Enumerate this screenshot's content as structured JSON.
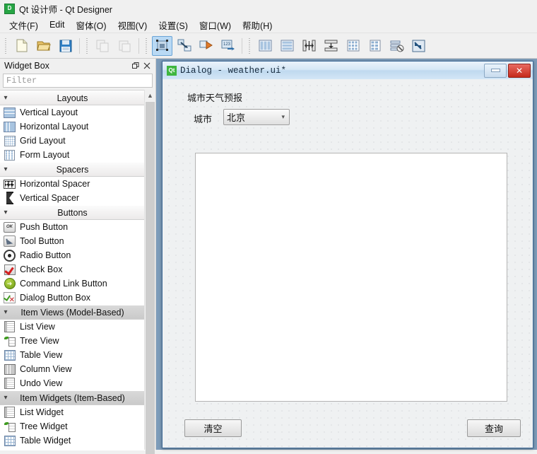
{
  "window": {
    "title": "Qt 设计师 - Qt Designer",
    "logo_text": "D",
    "logo_name": "qt-designer-logo-icon"
  },
  "menubar": {
    "items": [
      {
        "label": "文件(F)",
        "name": "menu-file"
      },
      {
        "label": "Edit",
        "name": "menu-edit"
      },
      {
        "label": "窗体(O)",
        "name": "menu-form"
      },
      {
        "label": "视图(V)",
        "name": "menu-view"
      },
      {
        "label": "设置(S)",
        "name": "menu-settings"
      },
      {
        "label": "窗口(W)",
        "name": "menu-window"
      },
      {
        "label": "帮助(H)",
        "name": "menu-help"
      }
    ]
  },
  "toolbar": {
    "groups": [
      {
        "name": "file-group",
        "buttons": [
          {
            "icon": "new-file-icon",
            "label": "新建",
            "enabled": true,
            "selected": false
          },
          {
            "icon": "open-folder-icon",
            "label": "打开",
            "enabled": true,
            "selected": false
          },
          {
            "icon": "save-icon",
            "label": "保存",
            "enabled": true,
            "selected": false
          }
        ]
      },
      {
        "name": "clipboard-group",
        "buttons": [
          {
            "icon": "copy-icon",
            "label": "复制",
            "enabled": false,
            "selected": false
          },
          {
            "icon": "paste-icon",
            "label": "粘贴",
            "enabled": false,
            "selected": false
          }
        ]
      },
      {
        "name": "mode-group",
        "buttons": [
          {
            "icon": "edit-widgets-icon",
            "label": "Edit Widgets",
            "enabled": true,
            "selected": true
          },
          {
            "icon": "edit-signals-slots-icon",
            "label": "Edit Signals/Slots",
            "enabled": true,
            "selected": false
          },
          {
            "icon": "edit-buddies-icon",
            "label": "Edit Buddies",
            "enabled": true,
            "selected": false
          },
          {
            "icon": "edit-tab-order-icon",
            "label": "Edit Tab Order",
            "enabled": true,
            "selected": false
          }
        ]
      },
      {
        "name": "layout-group",
        "buttons": [
          {
            "icon": "layout-horizontal-icon",
            "label": "水平布局",
            "enabled": true,
            "selected": false
          },
          {
            "icon": "layout-vertical-icon",
            "label": "垂直布局",
            "enabled": true,
            "selected": false
          },
          {
            "icon": "layout-splitter-horizontal-icon",
            "label": "水平分裂器布局",
            "enabled": true,
            "selected": false
          },
          {
            "icon": "layout-splitter-vertical-icon",
            "label": "垂直分裂器布局",
            "enabled": true,
            "selected": false
          },
          {
            "icon": "layout-grid-icon",
            "label": "栅格布局",
            "enabled": true,
            "selected": false
          },
          {
            "icon": "layout-form-icon",
            "label": "表单布局",
            "enabled": true,
            "selected": false
          },
          {
            "icon": "break-layout-icon",
            "label": "打破布局",
            "enabled": true,
            "selected": false
          },
          {
            "icon": "adjust-size-icon",
            "label": "调整大小",
            "enabled": true,
            "selected": false
          }
        ]
      }
    ]
  },
  "widget_box": {
    "title": "Widget Box",
    "float_icon": "float-dock-icon",
    "close_icon": "close-icon",
    "filter_placeholder": "Filter",
    "filter_value": "",
    "scrollbar": {
      "up_arrow": "chevron-up-icon"
    },
    "categories": [
      {
        "label": "Layouts",
        "name": "category-layouts",
        "expanded": true,
        "selected": false,
        "items": [
          {
            "label": "Vertical Layout",
            "icon": "vertical-layout-icon"
          },
          {
            "label": "Horizontal Layout",
            "icon": "horizontal-layout-icon"
          },
          {
            "label": "Grid Layout",
            "icon": "grid-layout-icon"
          },
          {
            "label": "Form Layout",
            "icon": "form-layout-icon"
          }
        ]
      },
      {
        "label": "Spacers",
        "name": "category-spacers",
        "expanded": true,
        "selected": false,
        "items": [
          {
            "label": "Horizontal Spacer",
            "icon": "horizontal-spacer-icon"
          },
          {
            "label": "Vertical Spacer",
            "icon": "vertical-spacer-icon"
          }
        ]
      },
      {
        "label": "Buttons",
        "name": "category-buttons",
        "expanded": true,
        "selected": false,
        "items": [
          {
            "label": "Push Button",
            "icon": "push-button-icon"
          },
          {
            "label": "Tool Button",
            "icon": "tool-button-icon"
          },
          {
            "label": "Radio Button",
            "icon": "radio-button-icon"
          },
          {
            "label": "Check Box",
            "icon": "check-box-icon"
          },
          {
            "label": "Command Link Button",
            "icon": "command-link-button-icon"
          },
          {
            "label": "Dialog Button Box",
            "icon": "dialog-button-box-icon"
          }
        ]
      },
      {
        "label": "Item Views (Model-Based)",
        "name": "category-item-views",
        "expanded": true,
        "selected": true,
        "items": [
          {
            "label": "List View",
            "icon": "list-view-icon"
          },
          {
            "label": "Tree View",
            "icon": "tree-view-icon"
          },
          {
            "label": "Table View",
            "icon": "table-view-icon"
          },
          {
            "label": "Column View",
            "icon": "column-view-icon"
          },
          {
            "label": "Undo View",
            "icon": "undo-view-icon"
          }
        ]
      },
      {
        "label": "Item Widgets (Item-Based)",
        "name": "category-item-widgets",
        "expanded": true,
        "selected": true,
        "items": [
          {
            "label": "List Widget",
            "icon": "list-widget-icon"
          },
          {
            "label": "Tree Widget",
            "icon": "tree-widget-icon"
          },
          {
            "label": "Table Widget",
            "icon": "table-widget-icon"
          }
        ]
      }
    ]
  },
  "dialog": {
    "logo_text": "Qt",
    "logo_name": "qt-logo-icon",
    "title": "Dialog - weather.ui*",
    "minimize_icon": "minimize-icon",
    "close_icon": "close-icon",
    "form": {
      "heading": "城市天气预报",
      "city_label": "城市",
      "city_combo_value": "北京",
      "city_combo_arrow": "chevron-down-icon",
      "text_area_value": "",
      "clear_button": "清空",
      "query_button": "查询"
    }
  }
}
